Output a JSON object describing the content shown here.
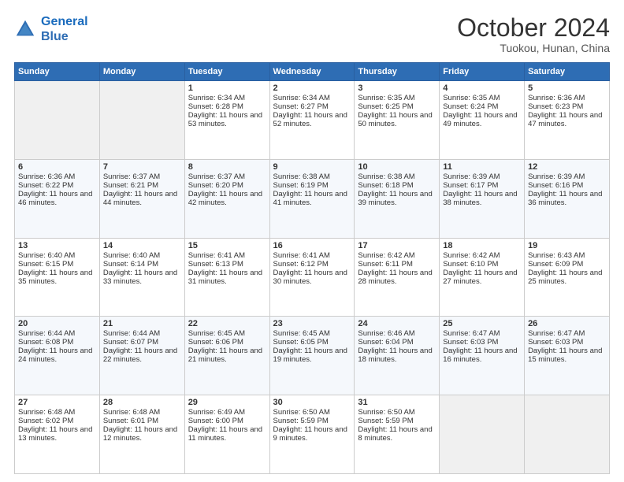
{
  "header": {
    "logo_line1": "General",
    "logo_line2": "Blue",
    "month": "October 2024",
    "location": "Tuokou, Hunan, China"
  },
  "days_of_week": [
    "Sunday",
    "Monday",
    "Tuesday",
    "Wednesday",
    "Thursday",
    "Friday",
    "Saturday"
  ],
  "weeks": [
    [
      {
        "day": "",
        "info": ""
      },
      {
        "day": "",
        "info": ""
      },
      {
        "day": "1",
        "info": "Sunrise: 6:34 AM\nSunset: 6:28 PM\nDaylight: 11 hours and 53 minutes."
      },
      {
        "day": "2",
        "info": "Sunrise: 6:34 AM\nSunset: 6:27 PM\nDaylight: 11 hours and 52 minutes."
      },
      {
        "day": "3",
        "info": "Sunrise: 6:35 AM\nSunset: 6:25 PM\nDaylight: 11 hours and 50 minutes."
      },
      {
        "day": "4",
        "info": "Sunrise: 6:35 AM\nSunset: 6:24 PM\nDaylight: 11 hours and 49 minutes."
      },
      {
        "day": "5",
        "info": "Sunrise: 6:36 AM\nSunset: 6:23 PM\nDaylight: 11 hours and 47 minutes."
      }
    ],
    [
      {
        "day": "6",
        "info": "Sunrise: 6:36 AM\nSunset: 6:22 PM\nDaylight: 11 hours and 46 minutes."
      },
      {
        "day": "7",
        "info": "Sunrise: 6:37 AM\nSunset: 6:21 PM\nDaylight: 11 hours and 44 minutes."
      },
      {
        "day": "8",
        "info": "Sunrise: 6:37 AM\nSunset: 6:20 PM\nDaylight: 11 hours and 42 minutes."
      },
      {
        "day": "9",
        "info": "Sunrise: 6:38 AM\nSunset: 6:19 PM\nDaylight: 11 hours and 41 minutes."
      },
      {
        "day": "10",
        "info": "Sunrise: 6:38 AM\nSunset: 6:18 PM\nDaylight: 11 hours and 39 minutes."
      },
      {
        "day": "11",
        "info": "Sunrise: 6:39 AM\nSunset: 6:17 PM\nDaylight: 11 hours and 38 minutes."
      },
      {
        "day": "12",
        "info": "Sunrise: 6:39 AM\nSunset: 6:16 PM\nDaylight: 11 hours and 36 minutes."
      }
    ],
    [
      {
        "day": "13",
        "info": "Sunrise: 6:40 AM\nSunset: 6:15 PM\nDaylight: 11 hours and 35 minutes."
      },
      {
        "day": "14",
        "info": "Sunrise: 6:40 AM\nSunset: 6:14 PM\nDaylight: 11 hours and 33 minutes."
      },
      {
        "day": "15",
        "info": "Sunrise: 6:41 AM\nSunset: 6:13 PM\nDaylight: 11 hours and 31 minutes."
      },
      {
        "day": "16",
        "info": "Sunrise: 6:41 AM\nSunset: 6:12 PM\nDaylight: 11 hours and 30 minutes."
      },
      {
        "day": "17",
        "info": "Sunrise: 6:42 AM\nSunset: 6:11 PM\nDaylight: 11 hours and 28 minutes."
      },
      {
        "day": "18",
        "info": "Sunrise: 6:42 AM\nSunset: 6:10 PM\nDaylight: 11 hours and 27 minutes."
      },
      {
        "day": "19",
        "info": "Sunrise: 6:43 AM\nSunset: 6:09 PM\nDaylight: 11 hours and 25 minutes."
      }
    ],
    [
      {
        "day": "20",
        "info": "Sunrise: 6:44 AM\nSunset: 6:08 PM\nDaylight: 11 hours and 24 minutes."
      },
      {
        "day": "21",
        "info": "Sunrise: 6:44 AM\nSunset: 6:07 PM\nDaylight: 11 hours and 22 minutes."
      },
      {
        "day": "22",
        "info": "Sunrise: 6:45 AM\nSunset: 6:06 PM\nDaylight: 11 hours and 21 minutes."
      },
      {
        "day": "23",
        "info": "Sunrise: 6:45 AM\nSunset: 6:05 PM\nDaylight: 11 hours and 19 minutes."
      },
      {
        "day": "24",
        "info": "Sunrise: 6:46 AM\nSunset: 6:04 PM\nDaylight: 11 hours and 18 minutes."
      },
      {
        "day": "25",
        "info": "Sunrise: 6:47 AM\nSunset: 6:03 PM\nDaylight: 11 hours and 16 minutes."
      },
      {
        "day": "26",
        "info": "Sunrise: 6:47 AM\nSunset: 6:03 PM\nDaylight: 11 hours and 15 minutes."
      }
    ],
    [
      {
        "day": "27",
        "info": "Sunrise: 6:48 AM\nSunset: 6:02 PM\nDaylight: 11 hours and 13 minutes."
      },
      {
        "day": "28",
        "info": "Sunrise: 6:48 AM\nSunset: 6:01 PM\nDaylight: 11 hours and 12 minutes."
      },
      {
        "day": "29",
        "info": "Sunrise: 6:49 AM\nSunset: 6:00 PM\nDaylight: 11 hours and 11 minutes."
      },
      {
        "day": "30",
        "info": "Sunrise: 6:50 AM\nSunset: 5:59 PM\nDaylight: 11 hours and 9 minutes."
      },
      {
        "day": "31",
        "info": "Sunrise: 6:50 AM\nSunset: 5:59 PM\nDaylight: 11 hours and 8 minutes."
      },
      {
        "day": "",
        "info": ""
      },
      {
        "day": "",
        "info": ""
      }
    ]
  ]
}
